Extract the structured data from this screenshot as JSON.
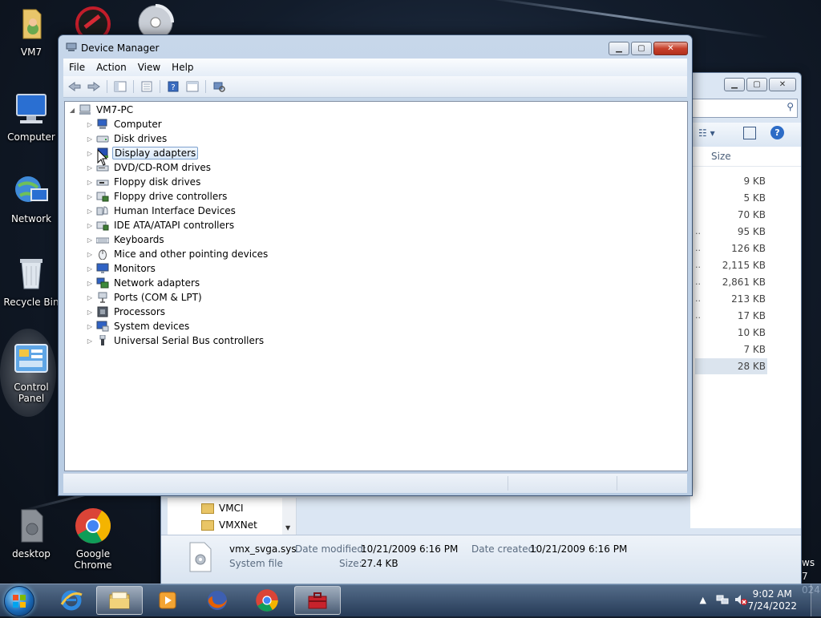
{
  "desktop": {
    "icons": [
      {
        "label": "VM7",
        "icon": "user-folder-icon"
      },
      {
        "label": "Computer",
        "icon": "computer-icon"
      },
      {
        "label": "Network",
        "icon": "network-icon"
      },
      {
        "label": "Recycle Bin",
        "icon": "recycle-bin-icon"
      },
      {
        "label": "Control Panel",
        "icon": "control-panel-icon"
      },
      {
        "label": "desktop",
        "icon": "desktop-file-icon"
      },
      {
        "label": "Google\nChrome",
        "icon": "chrome-icon"
      }
    ],
    "watermark_line1": "ws 7",
    "watermark_line2": "024"
  },
  "explorer": {
    "column_header": "Size",
    "sizes": [
      "9 KB",
      "5 KB",
      "70 KB",
      "95 KB",
      "126 KB",
      "2,115 KB",
      "2,861 KB",
      "213 KB",
      "17 KB",
      "10 KB",
      "7 KB",
      "28 KB"
    ],
    "nav_items": [
      "VMCI",
      "VMXNet"
    ],
    "details": {
      "filename": "vmx_svga.sys",
      "type": "System file",
      "date_modified_label": "Date modified:",
      "date_modified": "10/21/2009 6:16 PM",
      "date_created_label": "Date created:",
      "date_created": "10/21/2009 6:16 PM",
      "size_label": "Size:",
      "size": "27.4 KB"
    }
  },
  "device_manager": {
    "title": "Device Manager",
    "menu": [
      "File",
      "Action",
      "View",
      "Help"
    ],
    "toolbar": [
      "back-arrow-icon",
      "forward-arrow-icon",
      "show-hide-tree-icon",
      "properties-icon",
      "help-icon",
      "action-pane-icon",
      "scan-hardware-icon"
    ],
    "root": "VM7-PC",
    "categories": [
      {
        "label": "Computer",
        "icon": "computer-icon"
      },
      {
        "label": "Disk drives",
        "icon": "disk-drive-icon"
      },
      {
        "label": "Display adapters",
        "icon": "display-adapter-icon",
        "selected": true
      },
      {
        "label": "DVD/CD-ROM drives",
        "icon": "dvd-drive-icon"
      },
      {
        "label": "Floppy disk drives",
        "icon": "floppy-drive-icon"
      },
      {
        "label": "Floppy drive controllers",
        "icon": "floppy-controller-icon"
      },
      {
        "label": "Human Interface Devices",
        "icon": "hid-icon"
      },
      {
        "label": "IDE ATA/ATAPI controllers",
        "icon": "ide-controller-icon"
      },
      {
        "label": "Keyboards",
        "icon": "keyboard-icon"
      },
      {
        "label": "Mice and other pointing devices",
        "icon": "mouse-icon"
      },
      {
        "label": "Monitors",
        "icon": "monitor-icon"
      },
      {
        "label": "Network adapters",
        "icon": "network-adapter-icon"
      },
      {
        "label": "Ports (COM & LPT)",
        "icon": "port-icon"
      },
      {
        "label": "Processors",
        "icon": "processor-icon"
      },
      {
        "label": "System devices",
        "icon": "system-device-icon"
      },
      {
        "label": "Universal Serial Bus controllers",
        "icon": "usb-icon"
      }
    ]
  },
  "taskbar": {
    "apps": [
      "internet-explorer-icon",
      "windows-explorer-icon",
      "media-player-icon",
      "firefox-icon",
      "chrome-icon",
      "toolbox-icon"
    ],
    "time": "9:02 AM",
    "date": "7/24/2022"
  }
}
